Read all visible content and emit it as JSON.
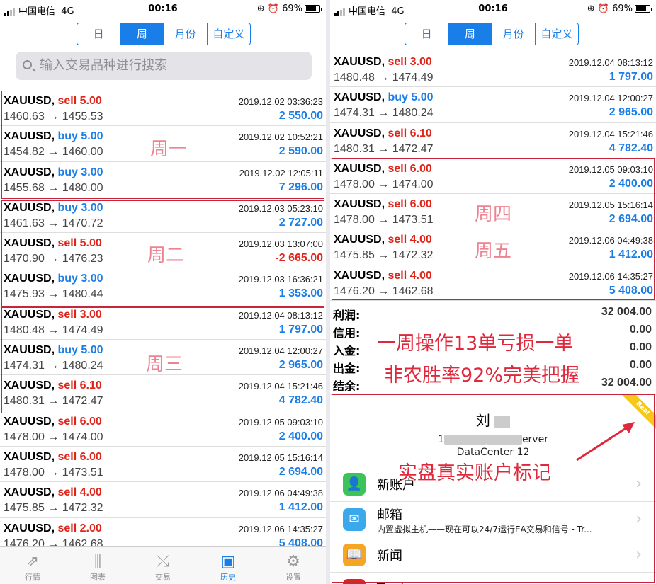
{
  "status": {
    "carrier": "中国电信",
    "network": "4G",
    "time": "00:16",
    "battery": "69%"
  },
  "periods": [
    "日",
    "周",
    "月份",
    "自定义"
  ],
  "active_period": "周",
  "search": {
    "placeholder": "输入交易品种进行搜索"
  },
  "left_trades": [
    {
      "symbol": "XAUUSD,",
      "action": "sell",
      "volume": "5.00",
      "time": "2019.12.02 03:36:23",
      "open": "1460.63",
      "close": "1455.53",
      "profit": "2 550.00"
    },
    {
      "symbol": "XAUUSD,",
      "action": "buy",
      "volume": "5.00",
      "time": "2019.12.02 10:52:21",
      "open": "1454.82",
      "close": "1460.00",
      "profit": "2 590.00"
    },
    {
      "symbol": "XAUUSD,",
      "action": "buy",
      "volume": "3.00",
      "time": "2019.12.02 12:05:11",
      "open": "1455.68",
      "close": "1480.00",
      "profit": "7 296.00"
    },
    {
      "symbol": "XAUUSD,",
      "action": "buy",
      "volume": "3.00",
      "time": "2019.12.03 05:23:10",
      "open": "1461.63",
      "close": "1470.72",
      "profit": "2 727.00"
    },
    {
      "symbol": "XAUUSD,",
      "action": "sell",
      "volume": "5.00",
      "time": "2019.12.03 13:07:00",
      "open": "1470.90",
      "close": "1476.23",
      "profit": "-2 665.00"
    },
    {
      "symbol": "XAUUSD,",
      "action": "buy",
      "volume": "3.00",
      "time": "2019.12.03 16:36:21",
      "open": "1475.93",
      "close": "1480.44",
      "profit": "1 353.00"
    },
    {
      "symbol": "XAUUSD,",
      "action": "sell",
      "volume": "3.00",
      "time": "2019.12.04 08:13:12",
      "open": "1480.48",
      "close": "1474.49",
      "profit": "1 797.00"
    },
    {
      "symbol": "XAUUSD,",
      "action": "buy",
      "volume": "5.00",
      "time": "2019.12.04 12:00:27",
      "open": "1474.31",
      "close": "1480.24",
      "profit": "2 965.00"
    },
    {
      "symbol": "XAUUSD,",
      "action": "sell",
      "volume": "6.10",
      "time": "2019.12.04 15:21:46",
      "open": "1480.31",
      "close": "1472.47",
      "profit": "4 782.40"
    },
    {
      "symbol": "XAUUSD,",
      "action": "sell",
      "volume": "6.00",
      "time": "2019.12.05 09:03:10",
      "open": "1478.00",
      "close": "1474.00",
      "profit": "2 400.00"
    },
    {
      "symbol": "XAUUSD,",
      "action": "sell",
      "volume": "6.00",
      "time": "2019.12.05 15:16:14",
      "open": "1478.00",
      "close": "1473.51",
      "profit": "2 694.00"
    },
    {
      "symbol": "XAUUSD,",
      "action": "sell",
      "volume": "4.00",
      "time": "2019.12.06 04:49:38",
      "open": "1475.85",
      "close": "1472.32",
      "profit": "1 412.00"
    },
    {
      "symbol": "XAUUSD,",
      "action": "sell",
      "volume": "2.00",
      "time": "2019.12.06 14:35:27",
      "open": "1476.20",
      "close": "1462.68",
      "profit": "5 408.00"
    }
  ],
  "right_trades": [
    {
      "symbol": "XAUUSD,",
      "action": "sell",
      "volume": "3.00",
      "time": "2019.12.04 08:13:12",
      "open": "1480.48",
      "close": "1474.49",
      "profit": "1 797.00"
    },
    {
      "symbol": "XAUUSD,",
      "action": "buy",
      "volume": "5.00",
      "time": "2019.12.04 12:00:27",
      "open": "1474.31",
      "close": "1480.24",
      "profit": "2 965.00"
    },
    {
      "symbol": "XAUUSD,",
      "action": "sell",
      "volume": "6.10",
      "time": "2019.12.04 15:21:46",
      "open": "1480.31",
      "close": "1472.47",
      "profit": "4 782.40"
    },
    {
      "symbol": "XAUUSD,",
      "action": "sell",
      "volume": "6.00",
      "time": "2019.12.05 09:03:10",
      "open": "1478.00",
      "close": "1474.00",
      "profit": "2 400.00"
    },
    {
      "symbol": "XAUUSD,",
      "action": "sell",
      "volume": "6.00",
      "time": "2019.12.05 15:16:14",
      "open": "1478.00",
      "close": "1473.51",
      "profit": "2 694.00"
    },
    {
      "symbol": "XAUUSD,",
      "action": "sell",
      "volume": "4.00",
      "time": "2019.12.06 04:49:38",
      "open": "1475.85",
      "close": "1472.32",
      "profit": "1 412.00"
    },
    {
      "symbol": "XAUUSD,",
      "action": "sell",
      "volume": "4.00",
      "time": "2019.12.06 14:35:27",
      "open": "1476.20",
      "close": "1462.68",
      "profit": "5 408.00"
    }
  ],
  "summary": [
    {
      "label": "利润:",
      "value": "32 004.00"
    },
    {
      "label": "信用:",
      "value": "0.00"
    },
    {
      "label": "入金:",
      "value": "0.00"
    },
    {
      "label": "出金:",
      "value": "0.00"
    },
    {
      "label": "结余:",
      "value": "32 004.00"
    }
  ],
  "annotations": {
    "mon": "周一",
    "tue": "周二",
    "wed": "周三",
    "thu": "周四",
    "fri": "周五",
    "line1": "一周操作13单亏损一单",
    "line2": "非农胜率92%完美把握",
    "real_mark": "实盘真实账户标记"
  },
  "account": {
    "name": "刘",
    "server": "erver",
    "server_prefix": "1",
    "datacenter": "DataCenter 12",
    "badge": "Real"
  },
  "menu": [
    {
      "label": "新账户",
      "icon": "add-user-icon",
      "color": "#3cc45a"
    },
    {
      "label": "邮箱",
      "sub": "内置虚拟主机——现在可以24/7运行EA交易和信号 - Tr...",
      "icon": "mail-icon",
      "color": "#3aa8ea"
    },
    {
      "label": "新闻",
      "icon": "book-icon",
      "color": "#f5a623"
    },
    {
      "label": "Tradays",
      "icon": "tradays-icon",
      "color": "#e0241a"
    }
  ],
  "tabs": [
    {
      "label": "行情",
      "icon": "quotes-icon"
    },
    {
      "label": "图表",
      "icon": "chart-icon"
    },
    {
      "label": "交易",
      "icon": "trade-icon"
    },
    {
      "label": "历史",
      "icon": "history-icon"
    },
    {
      "label": "设置",
      "icon": "settings-icon"
    }
  ],
  "active_tab": "历史"
}
